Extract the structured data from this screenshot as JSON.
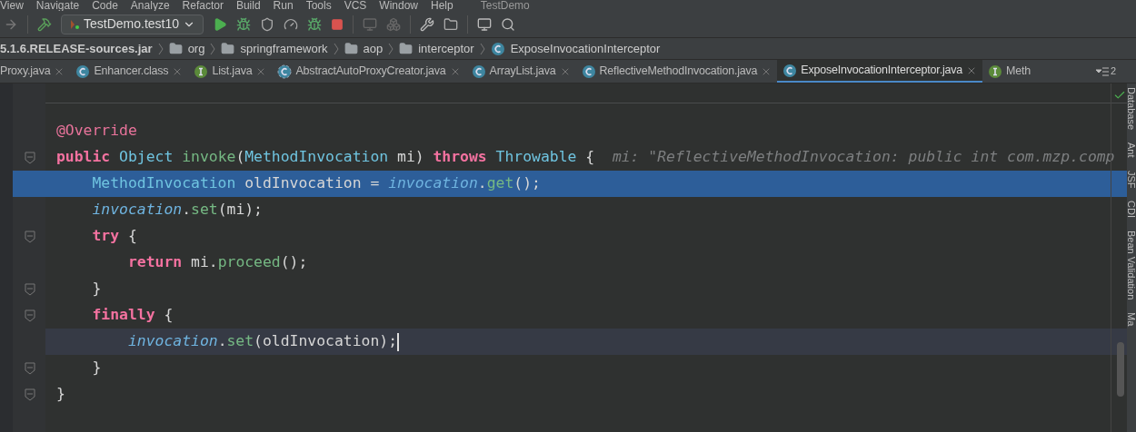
{
  "menu": [
    "View",
    "Navigate",
    "Code",
    "Analyze",
    "Refactor",
    "Build",
    "Run",
    "Tools",
    "VCS",
    "Window",
    "Help"
  ],
  "window": {
    "title": "TestDemo"
  },
  "toolbar": {
    "run_config": "TestDemo.test10"
  },
  "breadcrumb": [
    {
      "label": "5.1.6.RELEASE-sources.jar",
      "kind": "jar"
    },
    {
      "label": "org",
      "kind": "package"
    },
    {
      "label": "springframework",
      "kind": "package"
    },
    {
      "label": "aop",
      "kind": "package"
    },
    {
      "label": "interceptor",
      "kind": "package"
    },
    {
      "label": "ExposeInvocationInterceptor",
      "kind": "class"
    }
  ],
  "tabs": [
    {
      "label": "Proxy.java",
      "kind": "none",
      "selected": false
    },
    {
      "label": "Enhancer.class",
      "kind": "class",
      "selected": false
    },
    {
      "label": "List.java",
      "kind": "interface",
      "selected": false
    },
    {
      "label": "AbstractAutoProxyCreator.java",
      "kind": "abstract",
      "selected": false
    },
    {
      "label": "ArrayList.java",
      "kind": "class",
      "selected": false
    },
    {
      "label": "ReflectiveMethodInvocation.java",
      "kind": "class",
      "selected": false
    },
    {
      "label": "ExposeInvocationInterceptor.java",
      "kind": "class",
      "selected": true
    },
    {
      "label": "Meth",
      "kind": "interface",
      "selected": false
    }
  ],
  "tab_overflow": {
    "count": "2"
  },
  "code_lines": [
    {
      "fold": false,
      "selected": false,
      "current": false,
      "tokens": [
        {
          "kind": "annotation",
          "text": "@Override"
        }
      ]
    },
    {
      "fold": true,
      "selected": false,
      "current": false,
      "tokens": [
        {
          "kind": "keyword",
          "text": "public "
        },
        {
          "kind": "type",
          "text": "Object "
        },
        {
          "kind": "method",
          "text": "invoke"
        },
        {
          "kind": "plain",
          "text": "("
        },
        {
          "kind": "type",
          "text": "MethodInvocation "
        },
        {
          "kind": "plain",
          "text": "mi) "
        },
        {
          "kind": "keyword",
          "text": "throws "
        },
        {
          "kind": "type",
          "text": "Throwable "
        },
        {
          "kind": "plain",
          "text": "{  "
        },
        {
          "kind": "hint",
          "text": "mi: \"ReflectiveMethodInvocation: public int com.mzp.comp"
        }
      ]
    },
    {
      "fold": false,
      "selected": true,
      "current": false,
      "tokens": [
        {
          "kind": "type",
          "text": "    MethodInvocation "
        },
        {
          "kind": "plain",
          "text": "oldInvocation = "
        },
        {
          "kind": "field",
          "text": "invocation"
        },
        {
          "kind": "plain",
          "text": "."
        },
        {
          "kind": "method",
          "text": "get"
        },
        {
          "kind": "plain",
          "text": "();"
        }
      ]
    },
    {
      "fold": false,
      "selected": false,
      "current": false,
      "tokens": [
        {
          "kind": "field",
          "text": "    invocation"
        },
        {
          "kind": "plain",
          "text": "."
        },
        {
          "kind": "method",
          "text": "set"
        },
        {
          "kind": "plain",
          "text": "(mi);"
        }
      ]
    },
    {
      "fold": true,
      "selected": false,
      "current": false,
      "tokens": [
        {
          "kind": "keyword",
          "text": "    try "
        },
        {
          "kind": "plain",
          "text": "{"
        }
      ]
    },
    {
      "fold": false,
      "selected": false,
      "current": false,
      "tokens": [
        {
          "kind": "keyword",
          "text": "        return "
        },
        {
          "kind": "plain",
          "text": "mi."
        },
        {
          "kind": "method",
          "text": "proceed"
        },
        {
          "kind": "plain",
          "text": "();"
        }
      ]
    },
    {
      "fold": true,
      "selected": false,
      "current": false,
      "tokens": [
        {
          "kind": "plain",
          "text": "    }"
        }
      ]
    },
    {
      "fold": true,
      "selected": false,
      "current": false,
      "tokens": [
        {
          "kind": "keyword",
          "text": "    finally "
        },
        {
          "kind": "plain",
          "text": "{"
        }
      ]
    },
    {
      "fold": false,
      "selected": false,
      "current": true,
      "tokens": [
        {
          "kind": "field",
          "text": "        invocation"
        },
        {
          "kind": "plain",
          "text": "."
        },
        {
          "kind": "method",
          "text": "set"
        },
        {
          "kind": "plain",
          "text": "(oldInvocation);"
        }
      ]
    },
    {
      "fold": true,
      "selected": false,
      "current": false,
      "tokens": [
        {
          "kind": "plain",
          "text": "    }"
        }
      ]
    },
    {
      "fold": true,
      "selected": false,
      "current": false,
      "tokens": [
        {
          "kind": "plain",
          "text": "}"
        }
      ]
    }
  ],
  "right_panel": [
    "Database",
    "Ant",
    "JSF",
    "CDI",
    "Bean Validation",
    "Ma"
  ]
}
